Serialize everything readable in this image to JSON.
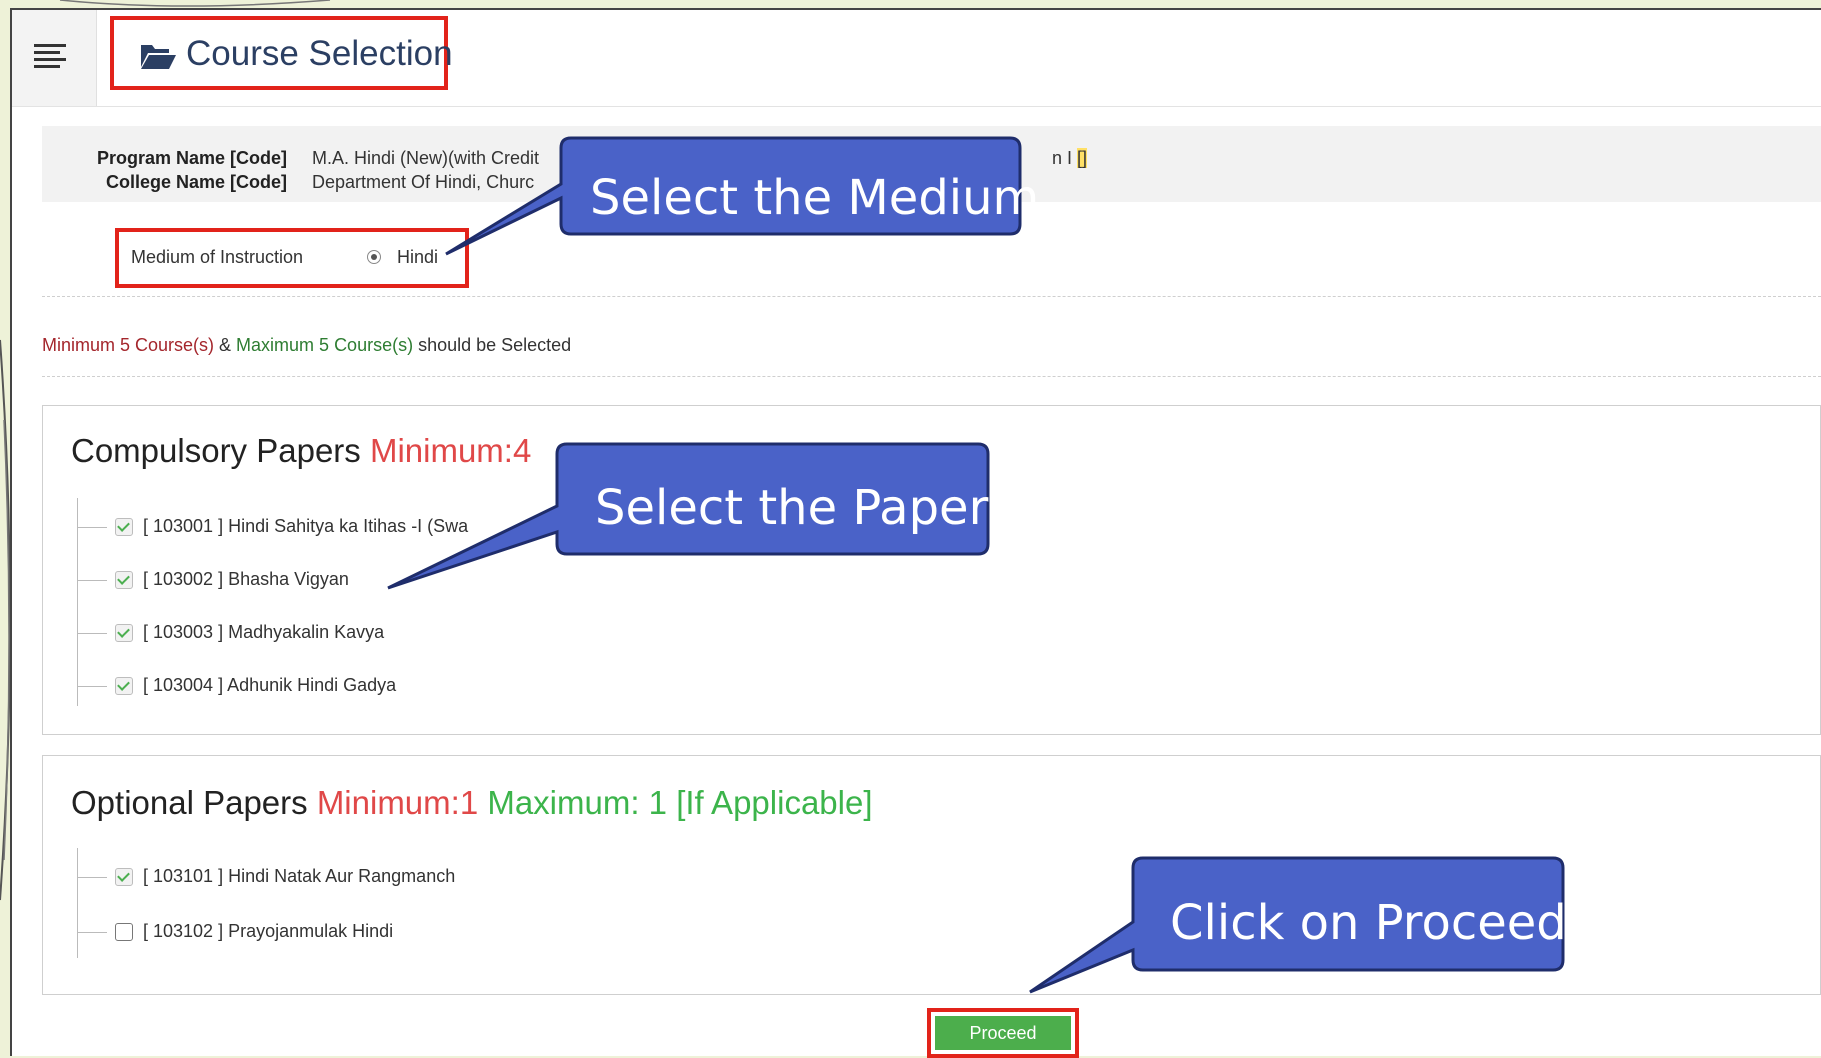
{
  "header": {
    "title": "Course Selection",
    "menu_icon": "hamburger-menu-icon",
    "folder_icon": "folder-open-icon"
  },
  "program": {
    "program_label": "Program Name [Code]",
    "program_value": "M.A. Hindi (New)(with Credit",
    "program_tail_text": "n I",
    "program_tail_code": "[]",
    "college_label": "College Name [Code]",
    "college_value": "Department Of Hindi, Churc"
  },
  "medium": {
    "label": "Medium of Instruction",
    "option": "Hindi"
  },
  "rule": {
    "min": "Minimum 5 Course(s)",
    "amp": " & ",
    "max": "Maximum 5 Course(s)",
    "suffix": " should be Selected"
  },
  "compulsory": {
    "title": "Compulsory Papers",
    "min": "Minimum:4",
    "items": [
      {
        "code": "[ 103001 ]",
        "name": "Hindi Sahitya ka Itihas -I (Swa",
        "checked": true
      },
      {
        "code": "[ 103002 ]",
        "name": "Bhasha Vigyan",
        "checked": true
      },
      {
        "code": "[ 103003 ]",
        "name": "Madhyakalin Kavya",
        "checked": true
      },
      {
        "code": "[ 103004 ]",
        "name": "Adhunik Hindi Gadya",
        "checked": true
      }
    ]
  },
  "optional": {
    "title": "Optional Papers",
    "min": "Minimum:1",
    "max": "Maximum: 1 [If Applicable]",
    "items": [
      {
        "code": "[ 103101 ]",
        "name": "Hindi Natak Aur Rangmanch",
        "checked": true
      },
      {
        "code": "[ 103102 ]",
        "name": "Prayojanmulak Hindi",
        "checked": false
      }
    ]
  },
  "proceed_label": "Proceed",
  "callouts": {
    "medium": "Select the Medium",
    "paper": "Select the Paper",
    "proceed": "Click on Proceed"
  },
  "colors": {
    "highlight_border": "#e2231a",
    "callout_fill": "#4a62c8",
    "minimum_text": "#e04848",
    "maximum_text": "#3cb44b",
    "proceed_button": "#4cae4c"
  }
}
